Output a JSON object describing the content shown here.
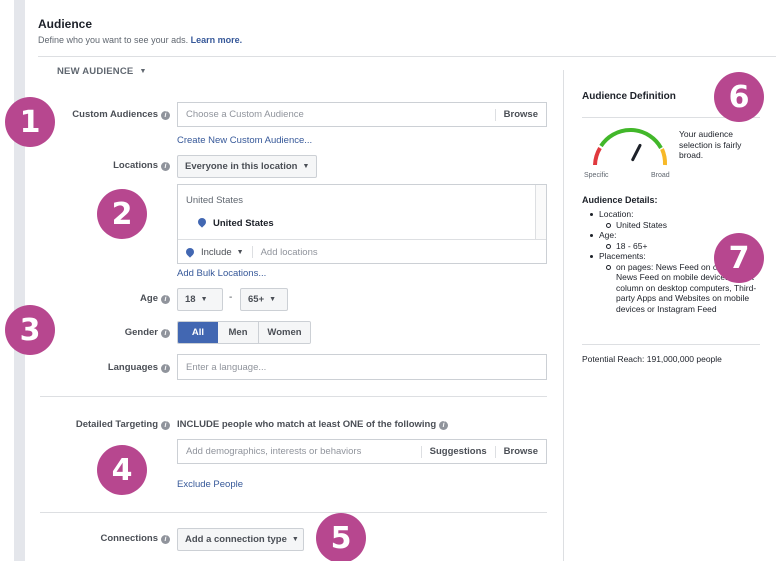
{
  "header": {
    "title": "Audience",
    "subtitle": "Define who you want to see your ads.",
    "learn_more": "Learn more."
  },
  "new_audience": "NEW AUDIENCE",
  "custom_audiences": {
    "label": "Custom Audiences",
    "placeholder": "Choose a Custom Audience",
    "browse": "Browse",
    "create_link": "Create New Custom Audience..."
  },
  "locations": {
    "label": "Locations",
    "dropdown": "Everyone in this location",
    "country_head": "United States",
    "country_item": "United States",
    "include": "Include",
    "add_placeholder": "Add locations",
    "bulk_link": "Add Bulk Locations..."
  },
  "age": {
    "label": "Age",
    "min": "18",
    "separator": "-",
    "max": "65+"
  },
  "gender": {
    "label": "Gender",
    "options": [
      "All",
      "Men",
      "Women"
    ],
    "selected": "All"
  },
  "languages": {
    "label": "Languages",
    "placeholder": "Enter a language..."
  },
  "detailed_targeting": {
    "label": "Detailed Targeting",
    "include_text": "INCLUDE people who match at least ONE of the following",
    "placeholder": "Add demographics, interests or behaviors",
    "suggestions": "Suggestions",
    "browse": "Browse",
    "exclude_link": "Exclude People"
  },
  "connections": {
    "label": "Connections",
    "dropdown": "Add a connection type"
  },
  "audience_definition": {
    "title": "Audience Definition",
    "gauge_specific": "Specific",
    "gauge_broad": "Broad",
    "gauge_level": 0.65,
    "description": "Your audience selection is fairly broad.",
    "details_title": "Audience Details:",
    "location_label": "Location:",
    "location_value": "United States",
    "age_label": "Age:",
    "age_value": "18 - 65+",
    "placements_label": "Placements:",
    "placements_value": "on pages: News Feed on computers, News Feed on mobile devices, Right column on desktop computers, Third-party Apps and Websites on mobile devices or Instagram Feed",
    "potential_reach": "Potential Reach: 191,000,000 people"
  },
  "badges": [
    "1",
    "2",
    "3",
    "4",
    "5",
    "6",
    "7"
  ],
  "colors": {
    "badge": "#b7478f",
    "primary_blue": "#4267b2",
    "link": "#365899",
    "gauge_red": "#e0393e",
    "gauge_green": "#42b72a",
    "gauge_orange": "#f7b928"
  }
}
